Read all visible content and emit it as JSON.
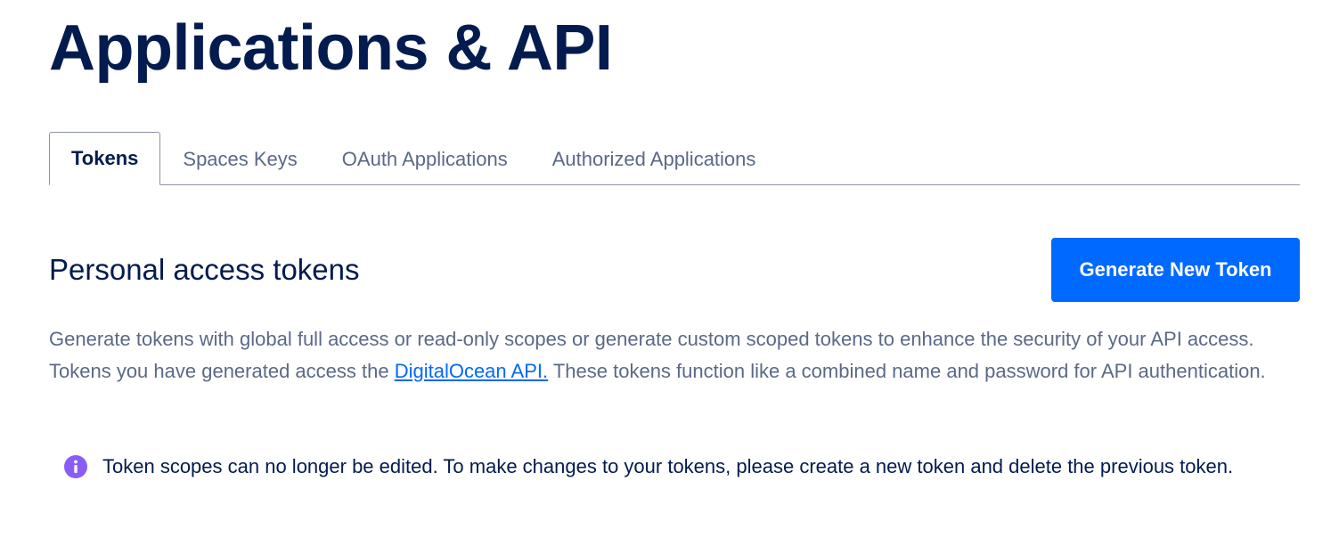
{
  "page": {
    "title": "Applications & API"
  },
  "tabs": [
    {
      "label": "Tokens",
      "active": true
    },
    {
      "label": "Spaces Keys",
      "active": false
    },
    {
      "label": "OAuth Applications",
      "active": false
    },
    {
      "label": "Authorized Applications",
      "active": false
    }
  ],
  "section": {
    "title": "Personal access tokens",
    "generate_button_label": "Generate New Token",
    "description_before_link": "Generate tokens with global full access or read-only scopes or generate custom scoped tokens to enhance the security of your API access. Tokens you have generated access the ",
    "description_link": "DigitalOcean API.",
    "description_after_link": " These tokens function like a combined name and password for API authentication."
  },
  "notice": {
    "icon": "info-icon",
    "text": "Token scopes can no longer be edited. To make changes to your tokens, please create a new token and delete the previous token."
  },
  "colors": {
    "heading": "#031b4e",
    "muted_text": "#5b6987",
    "primary": "#0069ff",
    "info_icon": "#8a5cf6",
    "tab_border": "#8d93a5"
  }
}
